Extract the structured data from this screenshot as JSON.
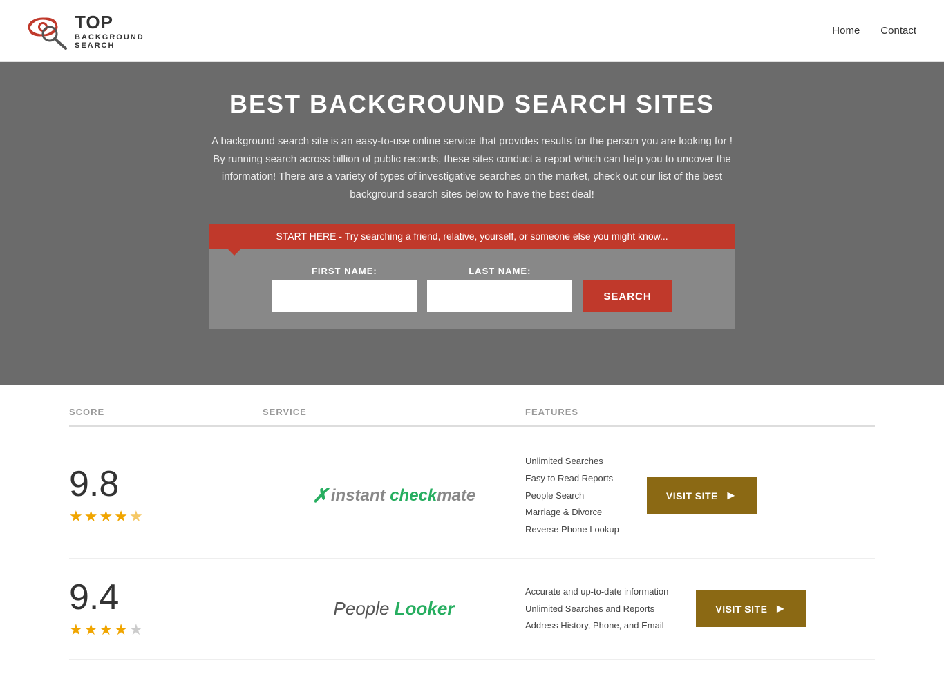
{
  "header": {
    "logo_top": "TOP",
    "logo_bottom": "BACKGROUND\nSEARCH",
    "nav": [
      {
        "label": "Home",
        "url": "#"
      },
      {
        "label": "Contact",
        "url": "#"
      }
    ]
  },
  "hero": {
    "title": "BEST BACKGROUND SEARCH SITES",
    "description": "A background search site is an easy-to-use online service that provides results  for the person you are looking for ! By  running  search across billion of public records, these sites conduct  a report which can help you to uncover the information! There are a variety of types of investigative searches on the market, check out our  list of the best background search sites below to have the best deal!",
    "search_banner": "START HERE - Try searching a friend, relative, yourself, or someone else you might know...",
    "form": {
      "first_name_label": "FIRST NAME:",
      "last_name_label": "LAST NAME:",
      "search_button": "SEARCH"
    }
  },
  "table": {
    "columns": [
      {
        "label": "SCORE"
      },
      {
        "label": "SERVICE"
      },
      {
        "label": "FEATURES"
      }
    ],
    "rows": [
      {
        "score": "9.8",
        "stars": 4.5,
        "service_name": "Instant Checkmate",
        "features": [
          "Unlimited Searches",
          "Easy to Read Reports",
          "People Search",
          "Marriage & Divorce",
          "Reverse Phone Lookup"
        ],
        "visit_label": "VISIT SITE",
        "visit_color": "#8b6914"
      },
      {
        "score": "9.4",
        "stars": 4,
        "service_name": "PeopleLooker",
        "features": [
          "Accurate and up-to-date information",
          "Unlimited Searches and Reports",
          "Address History, Phone, and Email"
        ],
        "visit_label": "VISIT SITE",
        "visit_color": "#8b6914"
      }
    ]
  }
}
